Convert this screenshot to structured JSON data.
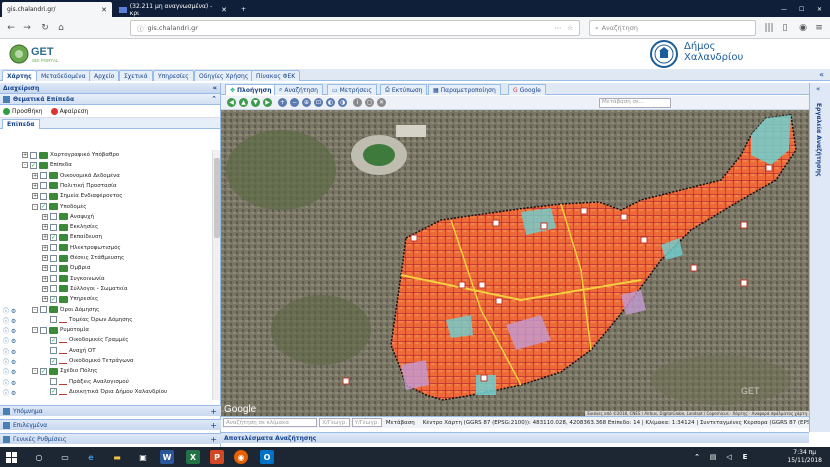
{
  "browser": {
    "tabs": [
      {
        "title": "gis.chalandri.gr/",
        "active": true
      },
      {
        "title": "(32.211 μη αναγνωσμένα) - κρι",
        "active": false
      }
    ],
    "url": "gis.chalandri.gr",
    "search_placeholder": "Αναζήτηση"
  },
  "header": {
    "logo_text": "GET",
    "logo_sub": "SDI PORTAL",
    "municipality_line1": "Δήμος",
    "municipality_line2": "Χαλανδρίου"
  },
  "menu": {
    "tabs": [
      "Χάρτης",
      "Μεταδεδομένα",
      "Αρχείο",
      "Σχετικά",
      "Υπηρεσίες",
      "Οδηγίες Χρήσης",
      "Πίνακας ΦΕΚ"
    ],
    "active": "Χάρτης"
  },
  "left": {
    "panel_title": "Διαχείριση",
    "section_title": "Θεματικά Επίπεδα",
    "add_label": "Προσθήκη",
    "remove_label": "Αφαίρεση",
    "layers_tab": "Επίπεδα",
    "tree": [
      {
        "label": "Χαρτογραφικό Υπόβαθρο",
        "indent": 0,
        "checked": false,
        "expand": "+"
      },
      {
        "label": "Επίπεδα",
        "indent": 0,
        "checked": true,
        "expand": "-"
      },
      {
        "label": "Οικονομικά Δεδομένα",
        "indent": 1,
        "checked": false,
        "expand": "+"
      },
      {
        "label": "Πολιτική Προστασία",
        "indent": 1,
        "checked": false,
        "expand": "+"
      },
      {
        "label": "Σημεία Ενδιαφέροντος",
        "indent": 1,
        "checked": false,
        "expand": "+"
      },
      {
        "label": "Υποδομές",
        "indent": 1,
        "checked": true,
        "expand": "-"
      },
      {
        "label": "Αναψυχή",
        "indent": 2,
        "checked": false,
        "expand": "+"
      },
      {
        "label": "Εκκλησίες",
        "indent": 2,
        "checked": false,
        "expand": "+"
      },
      {
        "label": "Εκπαίδευση",
        "indent": 2,
        "checked": true,
        "expand": "+"
      },
      {
        "label": "Ηλεκτροφωτισμός",
        "indent": 2,
        "checked": false,
        "expand": "+"
      },
      {
        "label": "Θέσεις Στάθμευσης",
        "indent": 2,
        "checked": false,
        "expand": "+"
      },
      {
        "label": "Όμβρια",
        "indent": 2,
        "checked": false,
        "expand": "+"
      },
      {
        "label": "Συγκοινωνία",
        "indent": 2,
        "checked": false,
        "expand": "+"
      },
      {
        "label": "Σύλλογοι - Σωματεία",
        "indent": 2,
        "checked": false,
        "expand": "+"
      },
      {
        "label": "Υπηρεσίες",
        "indent": 2,
        "checked": true,
        "expand": "+"
      },
      {
        "label": "Όροι Δόμησης",
        "indent": 1,
        "checked": false,
        "expand": "-"
      },
      {
        "label": "Τομέας Όρων Δόμησης",
        "indent": 2,
        "checked": false,
        "expand": ""
      },
      {
        "label": "Ρυμοτομία",
        "indent": 1,
        "checked": false,
        "expand": "-"
      },
      {
        "label": "Οικοδομικές Γραμμές",
        "indent": 2,
        "checked": true,
        "expand": ""
      },
      {
        "label": "Αναχή ΟΤ",
        "indent": 2,
        "checked": false,
        "expand": ""
      },
      {
        "label": "Οικοδομικό Τετράγωνα",
        "indent": 2,
        "checked": true,
        "expand": ""
      },
      {
        "label": "Σχέδιο Πόλης",
        "indent": 1,
        "checked": true,
        "expand": "-"
      },
      {
        "label": "Πράξεις Αναλογισμού",
        "indent": 2,
        "checked": false,
        "expand": ""
      },
      {
        "label": "Διοικητικά Όρια Δήμου Χαλανδρίου",
        "indent": 2,
        "checked": true,
        "expand": ""
      }
    ],
    "bottom_panels": [
      "Υπόμνημα",
      "Επιλεγμένα",
      "Γενικές Ρυθμίσεις"
    ]
  },
  "map": {
    "tabs": [
      "Πλοήγηση",
      "Αναζήτηση",
      "Μετρήσεις",
      "Εκτύπωση",
      "Παραμετροποίηση",
      "Google"
    ],
    "active_tab": "Πλοήγηση",
    "search_placeholder": "Μετάβαση σε...",
    "google_label": "Google",
    "attribution": "Εικόνες από ©2018, CNES / Airbus, DigitalGlobe, Landsat / Copernicus · Χάρτης · Αναφορά σφάλματος χάρτη",
    "status_search_placeholder": "Αναζήτηση σε κλίμακα",
    "status_x_placeholder": "Χ/Γεωγρ.",
    "status_y_placeholder": "Υ/Γεωγρ.",
    "status_go": "Μετάβαση",
    "status_text": "Κέντρο Χάρτη (GGRS 87 (EPSG:2100)): 483110.028, 4208363.368 Επίπεδο: 14 | Κλίμακα: 1:34124 | Συντεταγμένες Κέρσορα (GGRS 87 (EPSG:2100)): 48316",
    "results_title": "Αποτελέσματα Αναζήτησης",
    "right_strip_label": "Εργαλεία Αναζήτησης"
  },
  "taskbar": {
    "time": "7:34 πμ",
    "date": "15/11/2018"
  }
}
